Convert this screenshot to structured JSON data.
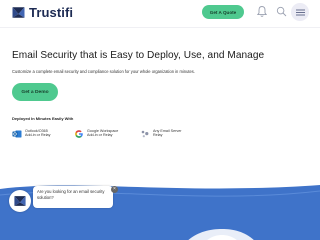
{
  "header": {
    "brand": "Trustifi",
    "quote_label": "Get A Quote",
    "icons": [
      "logo-icon",
      "bell-icon",
      "search-icon",
      "menu-icon"
    ]
  },
  "hero": {
    "title": "Email Security that is Easy to Deploy, Use, and Manage",
    "subtitle": "Customize a complete email security and compliance solution for your whole organization in minutes.",
    "demo_label": "Get a Demo",
    "deployed_heading": "Deployed In Minutes Easily With",
    "integrations": [
      {
        "line1": "Outlook/O365",
        "line2": "Add-in or Relay",
        "icon": "outlook-icon"
      },
      {
        "line1": "Google Workspace",
        "line2": "Add-in or Relay",
        "icon": "google-icon"
      },
      {
        "line1": "Any Email Server",
        "line2": "Relay",
        "icon": "server-icon"
      }
    ]
  },
  "chat": {
    "message": "Are you looking for an email security solution?",
    "close_symbol": "×"
  },
  "colors": {
    "accent_green": "#4fc98f",
    "band_blue": "#3f73c9",
    "brand_navy": "#1d2b53"
  }
}
